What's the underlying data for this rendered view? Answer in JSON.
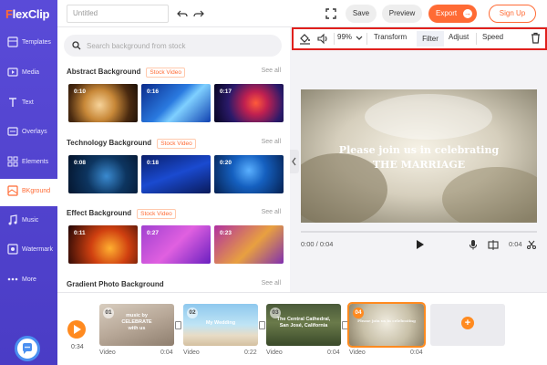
{
  "app": {
    "logo": "FlexClip",
    "logo_first": "F",
    "logo_rest": "lexClip"
  },
  "sidebar": {
    "items": [
      {
        "label": "Templates",
        "icon": "templates-icon"
      },
      {
        "label": "Media",
        "icon": "media-icon"
      },
      {
        "label": "Text",
        "icon": "text-icon"
      },
      {
        "label": "Overlays",
        "icon": "overlays-icon"
      },
      {
        "label": "Elements",
        "icon": "elements-icon"
      },
      {
        "label": "BKground",
        "icon": "background-icon",
        "active": true
      },
      {
        "label": "Music",
        "icon": "music-icon"
      },
      {
        "label": "Watermark",
        "icon": "watermark-icon"
      },
      {
        "label": "More",
        "icon": "more-icon"
      }
    ]
  },
  "header": {
    "title_placeholder": "Untitled",
    "save": "Save",
    "preview": "Preview",
    "export": "Export",
    "signup": "Sign Up"
  },
  "panel": {
    "search_placeholder": "Search background from stock",
    "see_all": "See all",
    "sections": [
      {
        "title": "Abstract Background",
        "badge": "Stock Video",
        "durations": [
          "0:10",
          "0:16",
          "0:17"
        ]
      },
      {
        "title": "Technology Background",
        "badge": "Stock Video",
        "durations": [
          "0:08",
          "0:18",
          "0:20"
        ]
      },
      {
        "title": "Effect Background",
        "badge": "Stock Video",
        "durations": [
          "0:11",
          "0:27",
          "0:23"
        ]
      },
      {
        "title": "Gradient Photo Background",
        "badge": "",
        "durations": []
      }
    ]
  },
  "toolbar": {
    "zoom": "99%",
    "transform": "Transform",
    "filter": "Filter",
    "adjust": "Adjust",
    "speed": "Speed"
  },
  "canvas": {
    "line1": "Please join us in celebrating",
    "line2": "THE MARRIAGE"
  },
  "player": {
    "time": "0:00 / 0:04",
    "duration": "0:04"
  },
  "timeline": {
    "current_time": "0:34",
    "clips": [
      {
        "num": "01",
        "label": "Video",
        "duration": "0:04",
        "text": "music by\nCELEBRATE\nwith us"
      },
      {
        "num": "02",
        "label": "Video",
        "duration": "0:22",
        "text": "My Wedding"
      },
      {
        "num": "03",
        "label": "Video",
        "duration": "0:04",
        "text": "The Central Cathedral,\nSan José, California"
      },
      {
        "num": "04",
        "label": "Video",
        "duration": "0:04",
        "text": "",
        "selected": true
      }
    ]
  }
}
